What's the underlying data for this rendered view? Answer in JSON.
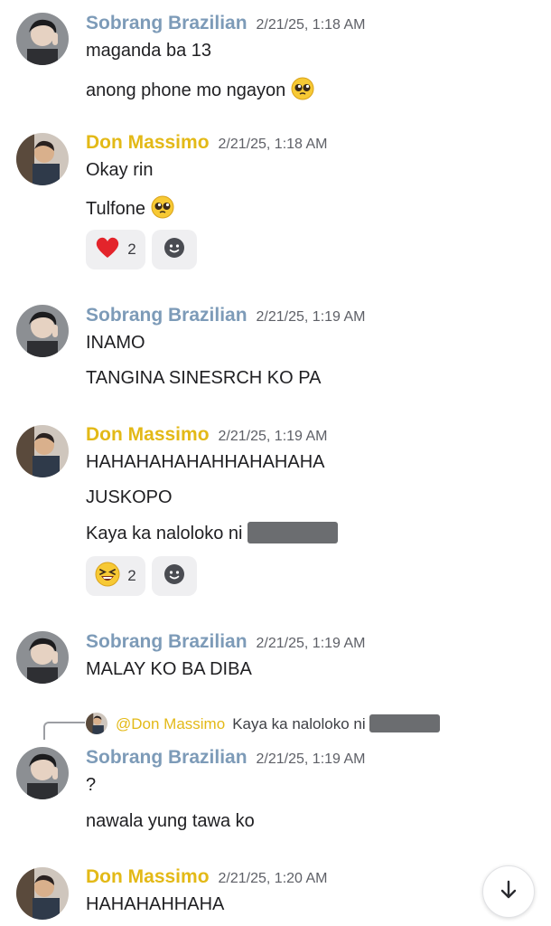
{
  "users": {
    "sobrang": {
      "name": "Sobrang Brazilian",
      "color": "#7d9bb8"
    },
    "don": {
      "name": "Don Massimo",
      "color": "#e3b917"
    }
  },
  "messages": [
    {
      "author": "Sobrang Brazilian",
      "timestamp": "2/21/25, 1:18 AM",
      "lines": [
        "maganda ba 13",
        "anong phone mo ngayon"
      ]
    },
    {
      "author": "Don Massimo",
      "timestamp": "2/21/25, 1:18 AM",
      "lines": [
        "Okay rin",
        "Tulfone"
      ],
      "reactions": [
        {
          "emoji": "heart-emoji",
          "count": "2"
        }
      ]
    },
    {
      "author": "Sobrang Brazilian",
      "timestamp": "2/21/25, 1:19 AM",
      "lines": [
        "INAMO",
        "TANGINA SINESRCH KO PA"
      ]
    },
    {
      "author": "Don Massimo",
      "timestamp": "2/21/25, 1:19 AM",
      "lines": [
        "HAHAHAHAHAHHAHAHAHA",
        "JUSKOPO",
        "Kaya ka naloloko ni"
      ],
      "reactions": [
        {
          "emoji": "laughing-emoji",
          "count": "2"
        }
      ]
    },
    {
      "author": "Sobrang Brazilian",
      "timestamp": "2/21/25, 1:19 AM",
      "lines": [
        "MALAY KO BA DIBA"
      ]
    },
    {
      "author": "Sobrang Brazilian",
      "timestamp": "2/21/25, 1:19 AM",
      "reply": {
        "mention": "@Don Massimo",
        "text": "Kaya ka naloloko ni"
      },
      "lines": [
        "?",
        "nawala yung tawa ko"
      ]
    },
    {
      "author": "Don Massimo",
      "timestamp": "2/21/25, 1:20 AM",
      "lines": [
        "HAHAHAHHAHA"
      ]
    }
  ],
  "icons": {
    "pleading": "pleading-face-emoji",
    "add_reaction": "smiley-add-reaction-icon",
    "scroll_down": "arrow-down-icon"
  },
  "colors": {
    "reaction_bg": "#efeff1",
    "redaction": "#6b6d70"
  }
}
